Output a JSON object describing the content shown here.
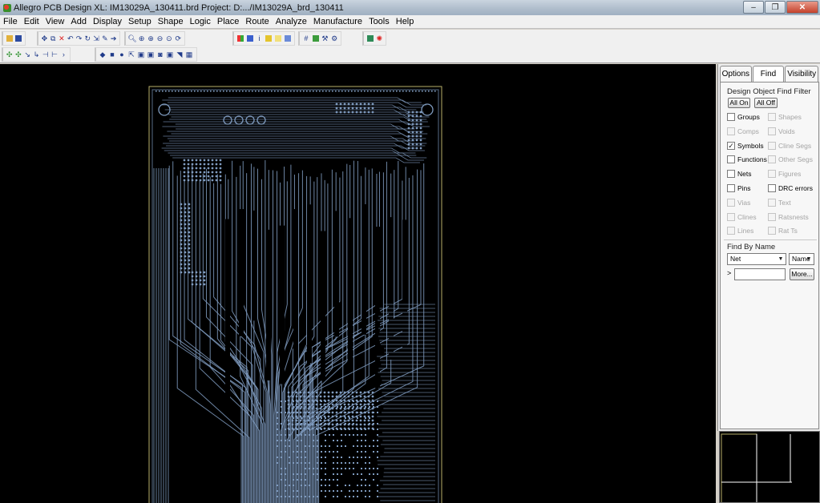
{
  "window": {
    "title": "Allegro PCB Design XL: IM13029A_130411.brd  Project: D:.../IM13029A_brd_130411",
    "min_glyph": "–",
    "max_glyph": "❐",
    "close_glyph": "✕"
  },
  "menu": [
    "File",
    "Edit",
    "View",
    "Add",
    "Display",
    "Setup",
    "Shape",
    "Logic",
    "Place",
    "Route",
    "Analyze",
    "Manufacture",
    "Tools",
    "Help"
  ],
  "panel": {
    "tabs": [
      "Options",
      "Find",
      "Visibility"
    ],
    "active_tab": "Find",
    "filter_title": "Design Object Find Filter",
    "all_on": "All On",
    "all_off": "All Off",
    "left_items": [
      {
        "label": "Groups",
        "checked": false,
        "enabled": true
      },
      {
        "label": "Comps",
        "checked": false,
        "enabled": false
      },
      {
        "label": "Symbols",
        "checked": true,
        "enabled": true
      },
      {
        "label": "Functions",
        "checked": false,
        "enabled": true
      },
      {
        "label": "Nets",
        "checked": false,
        "enabled": true
      },
      {
        "label": "Pins",
        "checked": false,
        "enabled": true
      },
      {
        "label": "Vias",
        "checked": false,
        "enabled": false
      },
      {
        "label": "Clines",
        "checked": false,
        "enabled": false
      },
      {
        "label": "Lines",
        "checked": false,
        "enabled": false
      }
    ],
    "right_items": [
      {
        "label": "Shapes",
        "checked": false,
        "enabled": false
      },
      {
        "label": "Voids",
        "checked": false,
        "enabled": false
      },
      {
        "label": "Cline Segs",
        "checked": false,
        "enabled": false
      },
      {
        "label": "Other Segs",
        "checked": false,
        "enabled": false
      },
      {
        "label": "Figures",
        "checked": false,
        "enabled": false
      },
      {
        "label": "DRC errors",
        "checked": false,
        "enabled": true
      },
      {
        "label": "Text",
        "checked": false,
        "enabled": false
      },
      {
        "label": "Ratsnests",
        "checked": false,
        "enabled": false
      },
      {
        "label": "Rat Ts",
        "checked": false,
        "enabled": false
      }
    ],
    "find_by_name_title": "Find By Name",
    "type_select": "Net",
    "mode_select": "Name",
    "name_prompt": ">",
    "name_value": "",
    "more_button": "More..."
  },
  "colors": {
    "trace": "#7f9bbf",
    "board_outline": "#b8b06a",
    "canvas": "#000000"
  }
}
